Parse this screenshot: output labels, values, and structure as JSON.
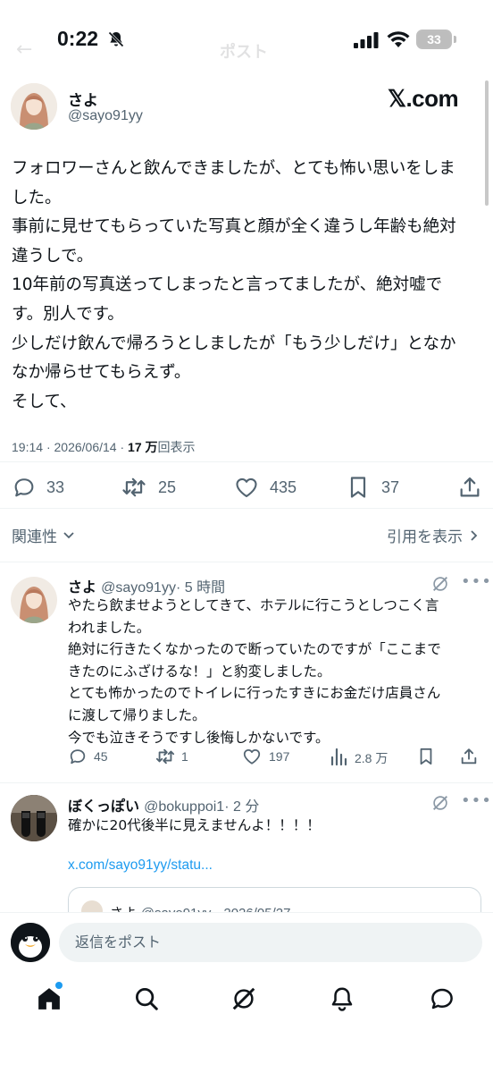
{
  "status_bar": {
    "time": "0:22",
    "battery": "33"
  },
  "nav": {
    "back_icon": "arrow-left-icon",
    "title": "ポスト"
  },
  "main_post": {
    "author_name": "さよ",
    "author_handle": "@sayo91yy",
    "brand": "𝕏.com",
    "text_lines": [
      "フォロワーさんと飲んできましたが、とても怖い思いをしま",
      "した。",
      "事前に見せてもらっていた写真と顔が全く違うし年齢も絶対",
      "違うしで。",
      "10年前の写真送ってしまったと言ってましたが、絶対嘘で",
      "す。別人です。",
      "少しだけ飲んで帰ろうとしましたが「もう少しだけ」となか",
      "なか帰らせてもらえず。",
      "そして、"
    ],
    "time": "19:14",
    "date": "2026/06/14",
    "views_count": "17 万",
    "views_label": "回表示",
    "actions": {
      "replies": "33",
      "reposts": "25",
      "likes": "435",
      "bookmarks": "37"
    }
  },
  "filters": {
    "sort_label": "関連性",
    "quotes_label": "引用を表示"
  },
  "replies": [
    {
      "name": "さよ",
      "handle": "@sayo91yy",
      "time": "· 5 時間",
      "text_lines": [
        "やたら飲ませようとしてきて、ホテルに行こうとしつこく言",
        "われました。",
        "絶対に行きたくなかったので断っていたのですが「ここまで",
        "きたのにふざけるな！」と豹変しました。",
        "とても怖かったのでトイレに行ったすきにお金だけ店員さん",
        "に渡して帰りました。",
        "今でも泣きそうですし後悔しかないです。"
      ],
      "actions": {
        "replies": "45",
        "reposts": "1",
        "likes": "197",
        "views": "2.8 万"
      }
    },
    {
      "name": "ぼくっぽい",
      "handle": "@bokuppoi1",
      "time": "· 2 分",
      "text_lines": [
        "確かに20代後半に見えませんよ！！！！"
      ],
      "link": "x.com/sayo91yy/statu...",
      "quoted": {
        "name": "さよ",
        "handle": "@sayo91yy",
        "date": "· 2026/05/27"
      }
    }
  ],
  "reply_bar": {
    "placeholder": "返信をポスト"
  },
  "tabs": [
    "home-icon",
    "search-icon",
    "grok-icon",
    "notifications-icon",
    "messages-icon"
  ]
}
